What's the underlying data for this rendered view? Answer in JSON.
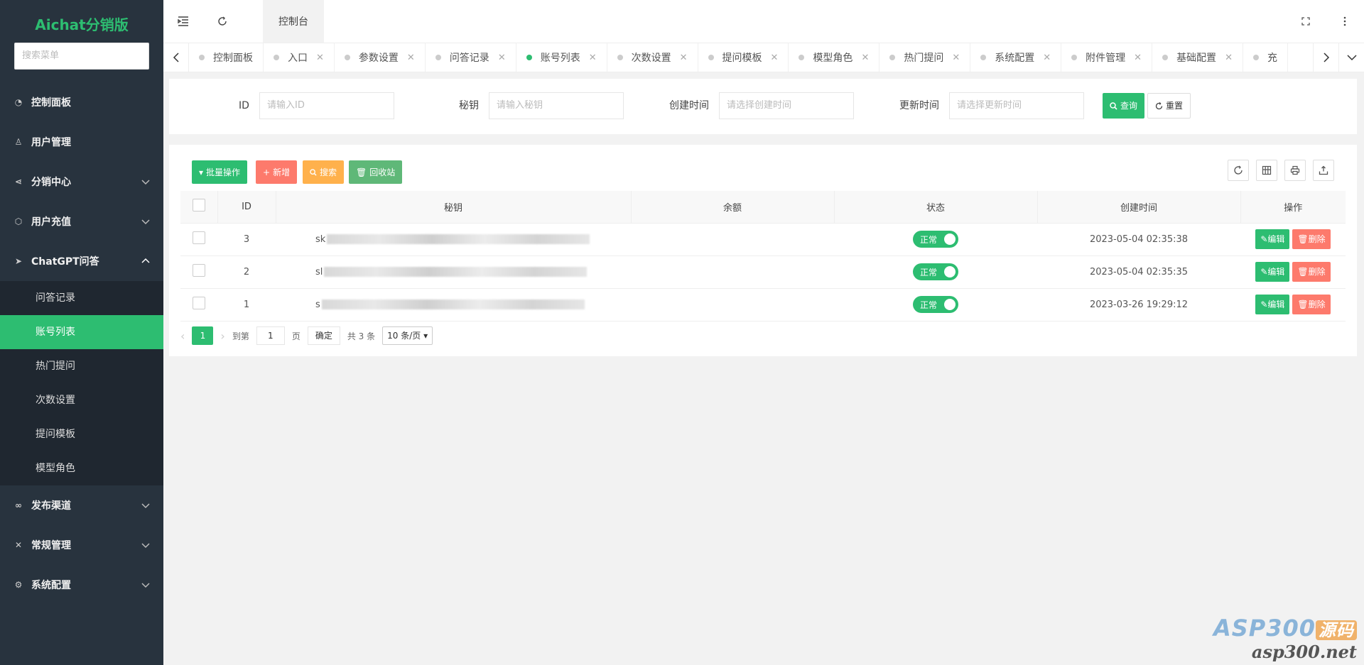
{
  "app": {
    "title": "Aichat分销版",
    "search_placeholder": "搜索菜单"
  },
  "menu": [
    {
      "label": "控制面板",
      "icon": "dashboard-icon"
    },
    {
      "label": "用户管理",
      "icon": "user-icon"
    },
    {
      "label": "分销中心",
      "icon": "share-icon"
    },
    {
      "label": "用户充值",
      "icon": "cube-icon"
    },
    {
      "label": "ChatGPT问答",
      "icon": "send-icon"
    },
    {
      "label": "发布渠道",
      "icon": "link-icon"
    },
    {
      "label": "常规管理",
      "icon": "wrench-icon"
    },
    {
      "label": "系统配置",
      "icon": "gear-icon"
    }
  ],
  "submenu": [
    "问答记录",
    "账号列表",
    "热门提问",
    "次数设置",
    "提问模板",
    "模型角色"
  ],
  "topbar": {
    "tab": "控制台"
  },
  "tabs": [
    "控制面板",
    "入口",
    "参数设置",
    "问答记录",
    "账号列表",
    "次数设置",
    "提问模板",
    "模型角色",
    "热门提问",
    "系统配置",
    "附件管理",
    "基础配置",
    "充"
  ],
  "filter": {
    "id_label": "ID",
    "id_placeholder": "请输入ID",
    "secret_label": "秘钥",
    "secret_placeholder": "请输入秘钥",
    "created_label": "创建时间",
    "created_placeholder": "请选择创建时间",
    "updated_label": "更新时间",
    "updated_placeholder": "请选择更新时间",
    "query": "查询",
    "reset": "重置"
  },
  "toolbar": {
    "batch": "批量操作",
    "add": "新增",
    "search": "搜索",
    "recycle": "回收站"
  },
  "table": {
    "headers": [
      "ID",
      "秘钥",
      "余额",
      "状态",
      "创建时间",
      "操作"
    ],
    "rows": [
      {
        "id": "3",
        "secret": "sk",
        "balance": "",
        "status": "正常",
        "created": "2023-05-04 02:35:38"
      },
      {
        "id": "2",
        "secret": "sl",
        "balance": "",
        "status": "正常",
        "created": "2023-05-04 02:35:35"
      },
      {
        "id": "1",
        "secret": "s",
        "balance": "",
        "status": "正常",
        "created": "2023-03-26 19:29:12"
      }
    ],
    "edit": "编辑",
    "delete": "删除"
  },
  "pager": {
    "current": "1",
    "goto": "到第",
    "page_input": "1",
    "page_unit": "页",
    "confirm": "确定",
    "total": "共 3 条",
    "per_page": "10 条/页"
  },
  "watermark": {
    "brand": "ASP300",
    "tag": "源码",
    "site": "asp300.net"
  },
  "colors": {
    "primary": "#2dbd71",
    "danger": "#fd7a6c",
    "warning": "#ffb14c",
    "sidebar": "#28333e"
  }
}
